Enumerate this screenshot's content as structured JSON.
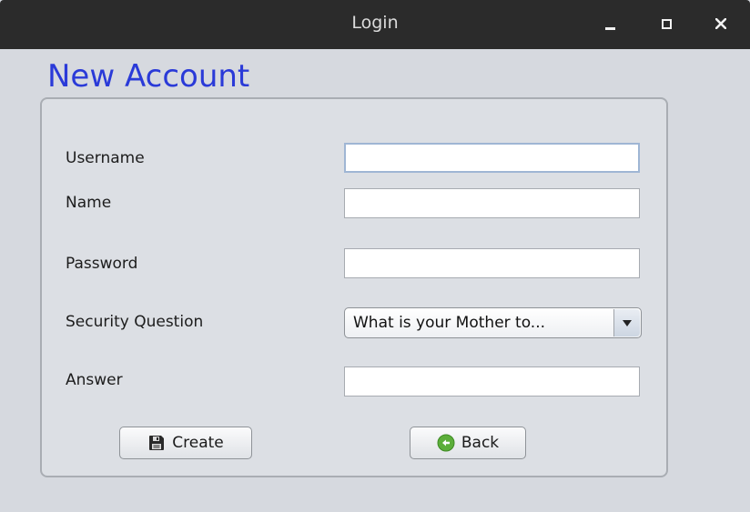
{
  "window": {
    "title": "Login",
    "controls": {
      "minimize": "minimize",
      "maximize": "maximize",
      "close": "close"
    }
  },
  "heading": "New Account",
  "form": {
    "username": {
      "label": "Username",
      "value": "",
      "placeholder": ""
    },
    "name": {
      "label": "Name",
      "value": "",
      "placeholder": ""
    },
    "password": {
      "label": "Password",
      "value": "",
      "placeholder": ""
    },
    "security_question": {
      "label": "Security Question",
      "selected": "What is your Mother to..."
    },
    "answer": {
      "label": "Answer",
      "value": "",
      "placeholder": ""
    }
  },
  "buttons": {
    "create_label": "Create",
    "back_label": "Back"
  },
  "icons": {
    "create": "save-icon",
    "back": "back-arrow-icon",
    "dropdown": "chevron-down-icon"
  },
  "colors": {
    "heading": "#2a3ad8",
    "titlebar": "#2b2b2b",
    "window_bg": "#d6d9df",
    "back_icon": "#5cae3a"
  }
}
